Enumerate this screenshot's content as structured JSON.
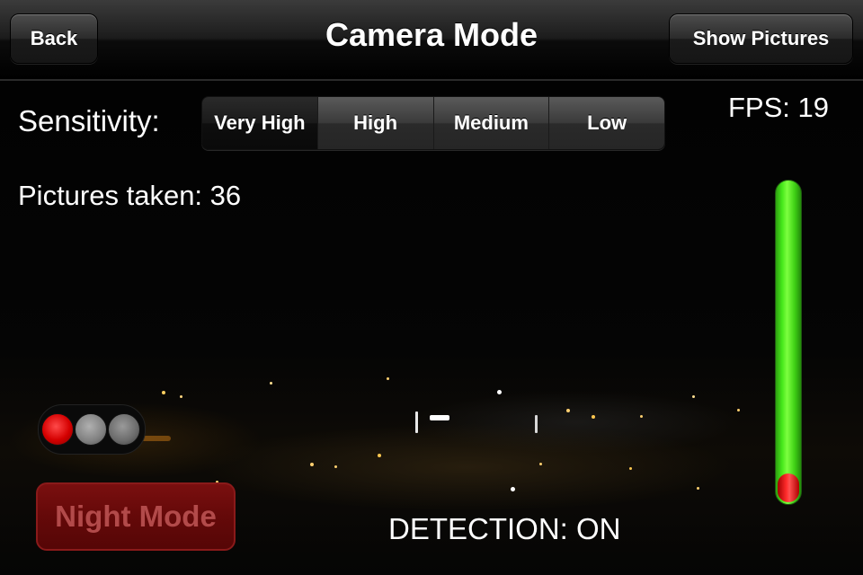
{
  "nav": {
    "back_label": "Back",
    "title": "Camera Mode",
    "show_pictures_label": "Show Pictures"
  },
  "sensitivity": {
    "label": "Sensitivity:",
    "options": [
      "Very High",
      "High",
      "Medium",
      "Low"
    ],
    "selected": "Very High"
  },
  "fps_text": "FPS: 19",
  "pictures_taken_text": "Pictures taken: 36",
  "level_meter": {
    "level_fraction": 0.09,
    "track_color": "#3fd015",
    "level_color": "#ff2b2b"
  },
  "indicator_lights": {
    "states": [
      "red",
      "off",
      "off"
    ]
  },
  "night_mode_label": "Night Mode",
  "detection_text": "DETECTION: ON",
  "colors": {
    "navbar": "#1c1c1c",
    "night_mode_bg": "#640909",
    "active_light": "#d40000"
  }
}
